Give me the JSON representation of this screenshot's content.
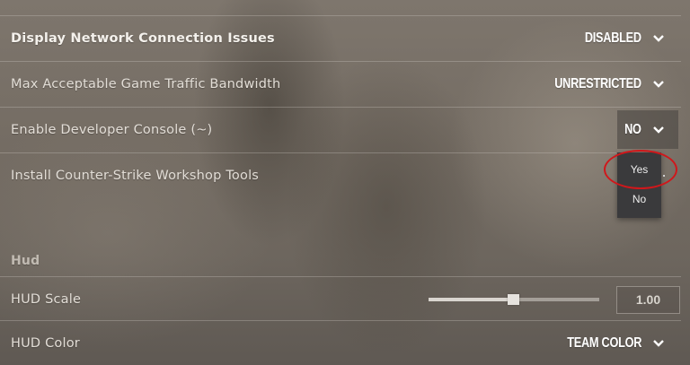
{
  "settings": [
    {
      "label": "Display Network Connection Issues",
      "value": "DISABLED"
    },
    {
      "label": "Max Acceptable Game Traffic Bandwidth",
      "value": "UNRESTRICTED"
    },
    {
      "label": "Enable Developer Console (~)",
      "value": "NO"
    },
    {
      "label": "Install Counter-Strike Workshop Tools"
    }
  ],
  "developer_console_dropdown": {
    "options": [
      "Yes",
      "No"
    ],
    "highlighted_option": "Yes",
    "highlight_color": "#d0171b"
  },
  "hud_section": {
    "title": "Hud",
    "hud_scale": {
      "label": "HUD Scale",
      "value": "1.00",
      "slider_fraction": 0.47
    },
    "hud_color": {
      "label": "HUD Color",
      "value": "TEAM COLOR"
    }
  },
  "icons": {
    "dropdown": "chevron-down-icon"
  }
}
